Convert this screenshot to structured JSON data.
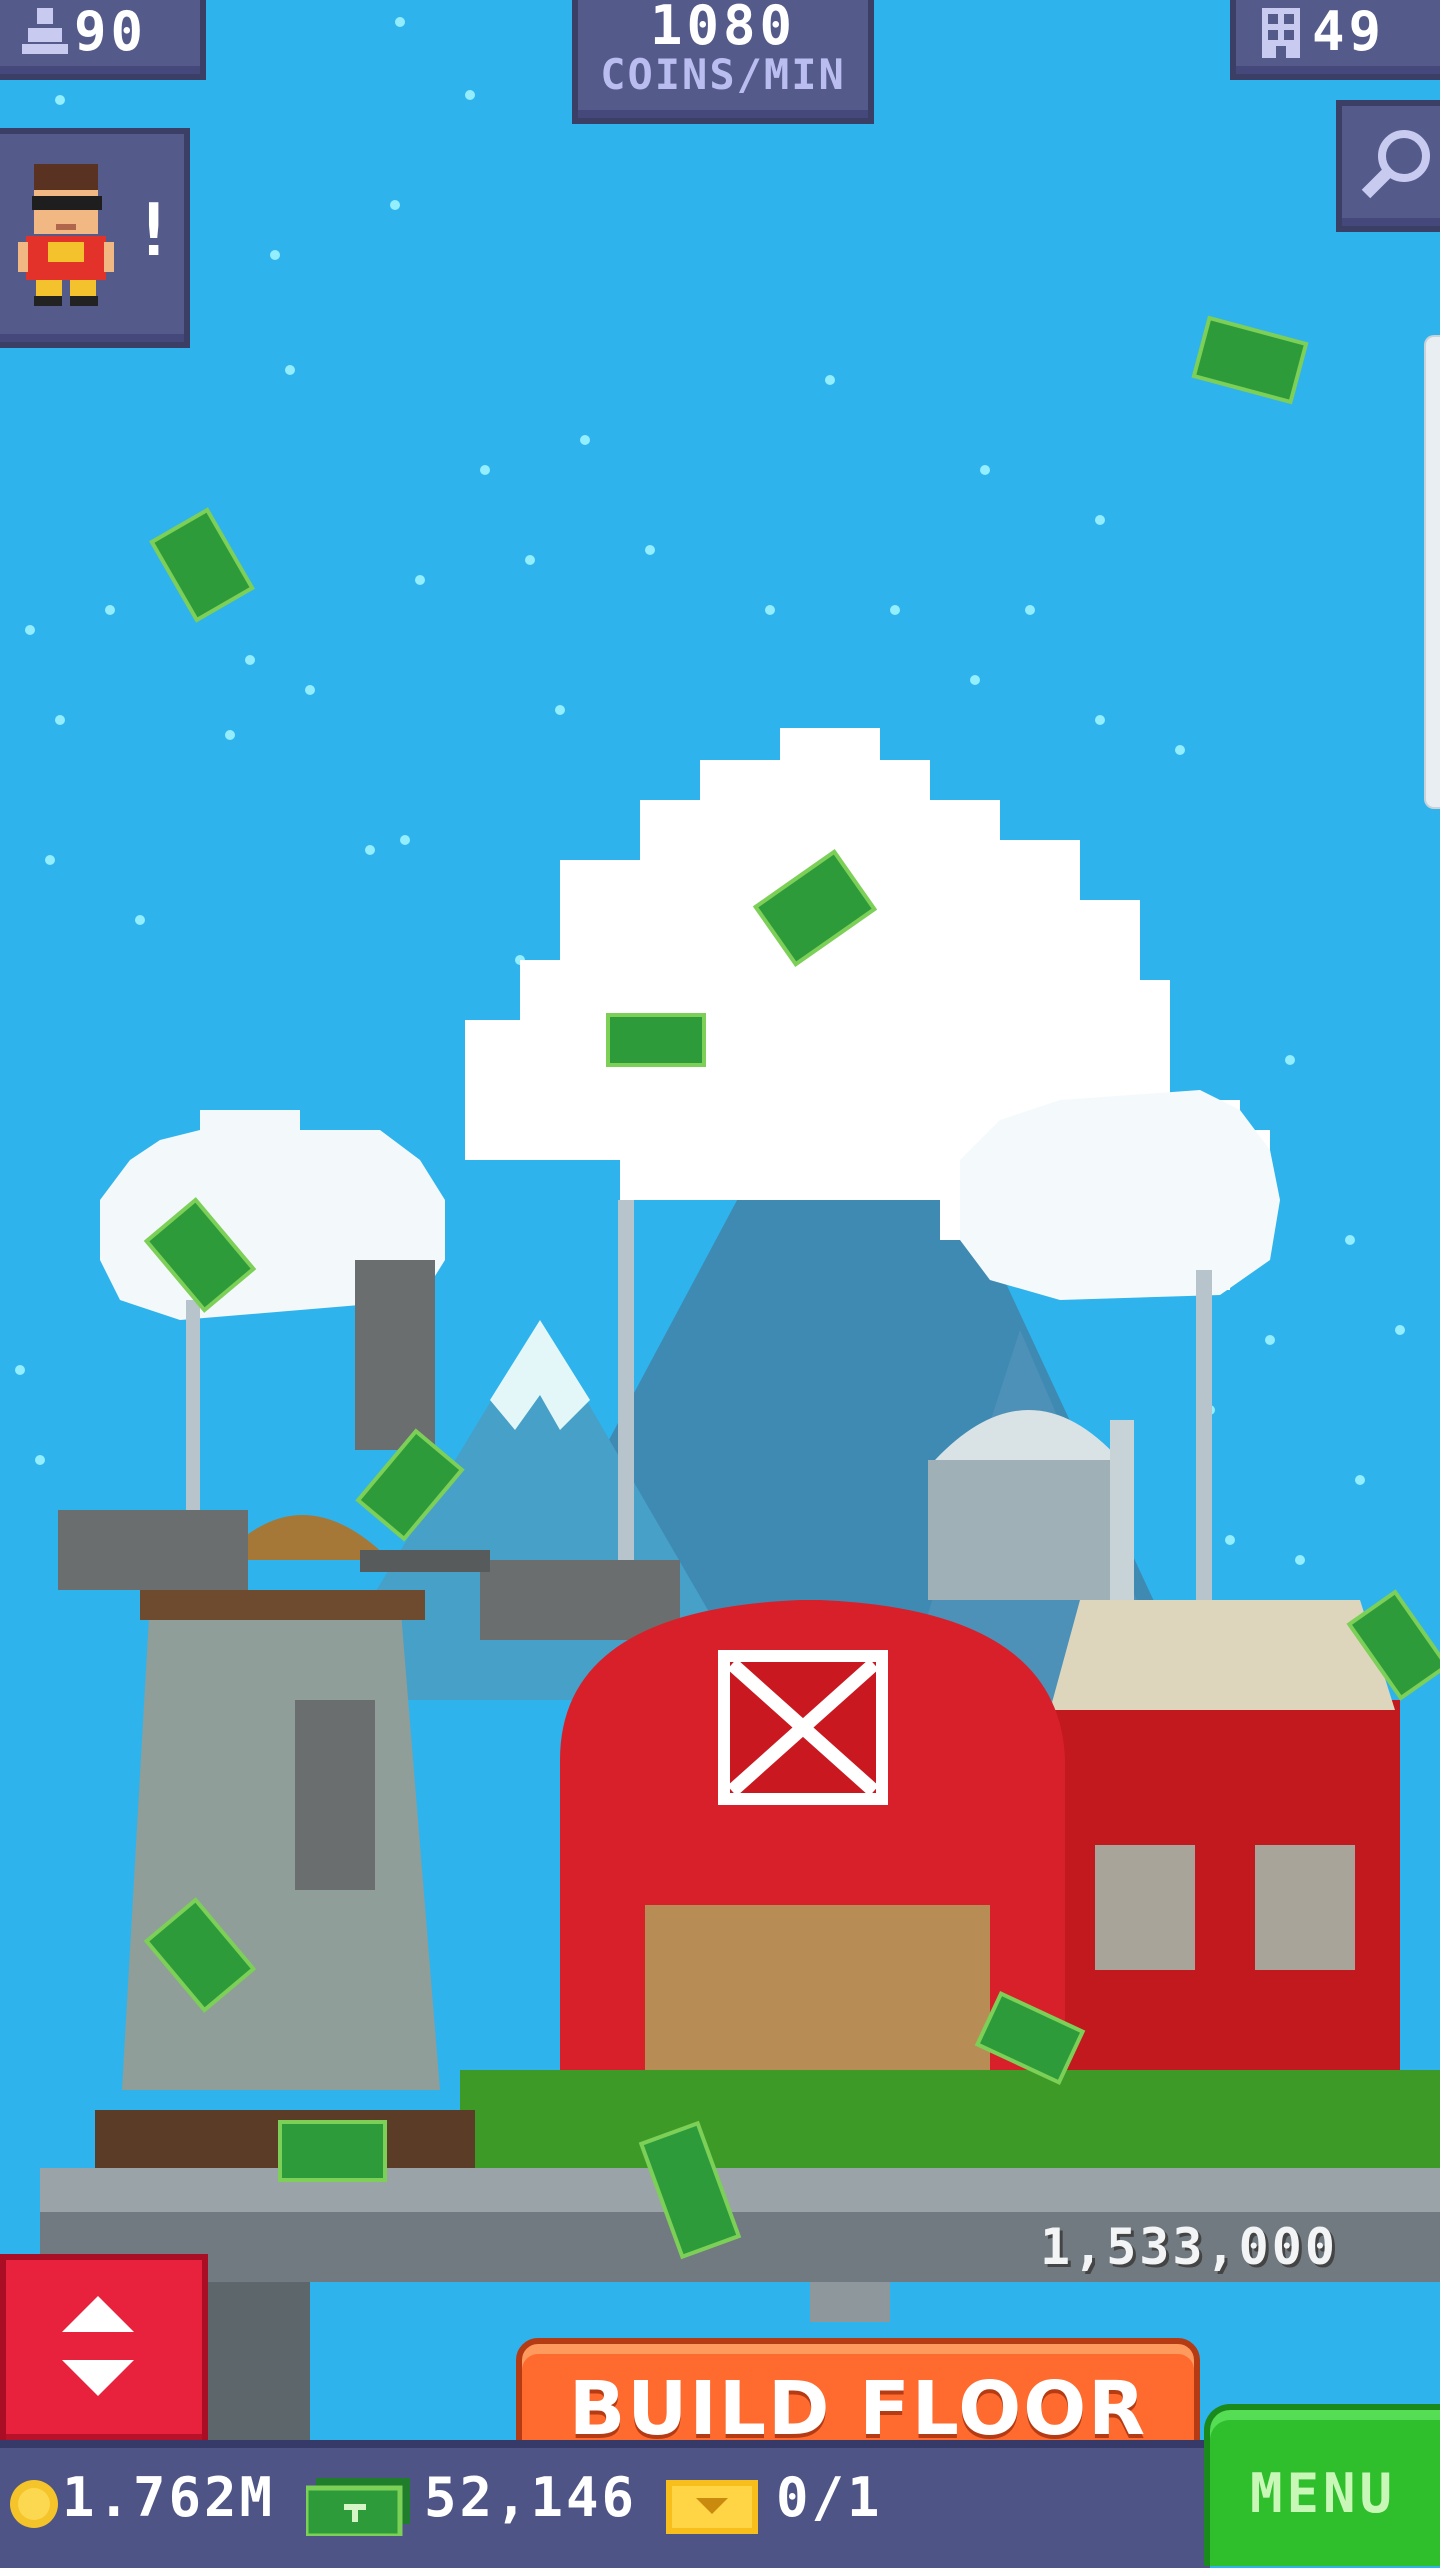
{
  "hud": {
    "population": "90",
    "coins_per_min_value": "1080",
    "coins_per_min_label": "COINS/MIN",
    "floors": "49",
    "alert_mark": "!"
  },
  "tower": {
    "floor_cost": "1,533,000"
  },
  "buttons": {
    "build_floor": "BUILD FLOOR",
    "menu": "MENU"
  },
  "bottom_bar": {
    "coins": "1.762M",
    "bux": "52,146",
    "tickets": "0/1"
  },
  "icons": {
    "population": "person-icon",
    "floors": "building-icon",
    "search": "magnifier-icon",
    "elevator": "up-down-arrows-icon",
    "coin": "coin-icon",
    "bux": "banknote-icon",
    "ticket": "ticket-icon"
  },
  "colors": {
    "sky": "#2fb3ec",
    "hud_panel": "#545a8a",
    "build_button": "#ff6a2e",
    "menu_button": "#2fbe2c",
    "elevator_button": "#e8223c",
    "barn_red": "#d8202a",
    "bux_green": "#2e9b3a"
  }
}
